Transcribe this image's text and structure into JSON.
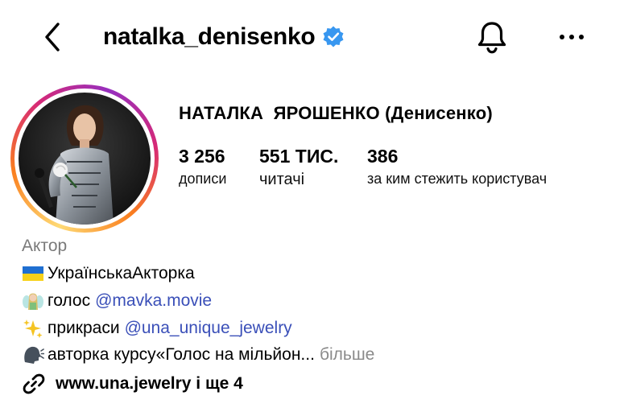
{
  "header": {
    "username": "natalka_denisenko"
  },
  "profile": {
    "full_name": "НАТАЛКА  ЯРОШЕНКО (Денисенко)",
    "stats": [
      {
        "value": "3 256",
        "label": "дописи"
      },
      {
        "value": "551 ТИС.",
        "label": "читачі"
      },
      {
        "value": "386",
        "label": "за ким стежить користувач"
      }
    ],
    "category": "Актор",
    "bio": {
      "line1": "УкраїнськаАкторка",
      "line2_text": "голос",
      "line2_mention": "@mavka.movie",
      "line3_text": "прикраси",
      "line3_mention": "@una_unique_jewelry",
      "line4_text": "авторка курсу«Голос на мільйон...",
      "line4_more": "більше"
    },
    "link": "www.una.jewelry і ще 4"
  },
  "colors": {
    "verified": "#3897f0",
    "mention": "#3a4fb8"
  },
  "icons": [
    "back-icon",
    "verified-icon",
    "bell-icon",
    "more-icon",
    "link-icon"
  ]
}
